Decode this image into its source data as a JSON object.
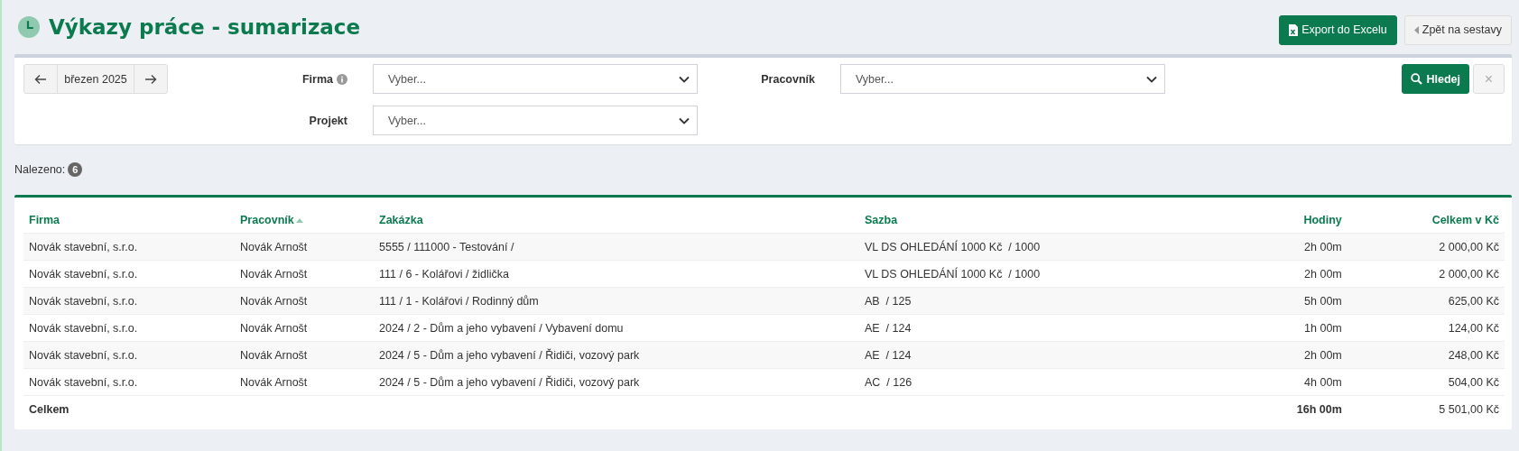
{
  "header": {
    "title": "Výkazy práce - sumarizace",
    "buttons": [
      {
        "label": "Export do Excelu",
        "kind": "primary"
      },
      {
        "label": "Zpět na sestavy",
        "kind": "back"
      }
    ]
  },
  "filter": {
    "period": {
      "label": "březen 2025"
    },
    "fields": [
      {
        "label": "Firma",
        "info": true,
        "placeholder": "Vyber..."
      },
      {
        "label": "Pracovník",
        "info": false,
        "placeholder": "Vyber..."
      },
      {
        "label": "Projekt",
        "info": false,
        "placeholder": "Vyber..."
      }
    ],
    "search_button": "Hledej",
    "clear_button": "×"
  },
  "found": {
    "label": "Nalezeno:",
    "count": "6"
  },
  "table": {
    "columns": [
      {
        "label": "Firma",
        "kind": "text",
        "sorted": false
      },
      {
        "label": "Pracovník",
        "kind": "text",
        "sorted": true
      },
      {
        "label": "Zakázka",
        "kind": "text",
        "sorted": false
      },
      {
        "label": "Sazba",
        "kind": "text",
        "sorted": false
      },
      {
        "label": "Hodiny",
        "kind": "number",
        "sorted": false
      },
      {
        "label": "Celkem v Kč",
        "kind": "number",
        "sorted": false
      }
    ],
    "rows": [
      [
        "Novák stavební, s.r.o.",
        "Novák Arnošt",
        "5555 / 111000 - Testování /",
        "VL DS OHLEDÁNÍ 1000 Kč  / 1000",
        "2h 00m",
        "2 000,00 Kč"
      ],
      [
        "Novák stavební, s.r.o.",
        "Novák Arnošt",
        "111 / 6 - Kolářovi / židlička",
        "VL DS OHLEDÁNÍ 1000 Kč  / 1000",
        "2h 00m",
        "2 000,00 Kč"
      ],
      [
        "Novák stavební, s.r.o.",
        "Novák Arnošt",
        "111 / 1 - Kolářovi / Rodinný dům",
        "AB  / 125",
        "5h 00m",
        "625,00 Kč"
      ],
      [
        "Novák stavební, s.r.o.",
        "Novák Arnošt",
        "2024 / 2 - Dům a jeho vybavení / Vybavení domu",
        "AE  / 124",
        "1h 00m",
        "124,00 Kč"
      ],
      [
        "Novák stavební, s.r.o.",
        "Novák Arnošt",
        "2024 / 5 - Dům a jeho vybavení / Řidiči, vozový park",
        "AE  / 124",
        "2h 00m",
        "248,00 Kč"
      ],
      [
        "Novák stavební, s.r.o.",
        "Novák Arnošt",
        "2024 / 5 - Dům a jeho vybavení / Řidiči, vozový park",
        "AC  / 126",
        "4h 00m",
        "504,00 Kč"
      ]
    ],
    "total": {
      "label": "Celkem",
      "hours": "16h 00m",
      "amount": "5 501,00 Kč"
    }
  }
}
